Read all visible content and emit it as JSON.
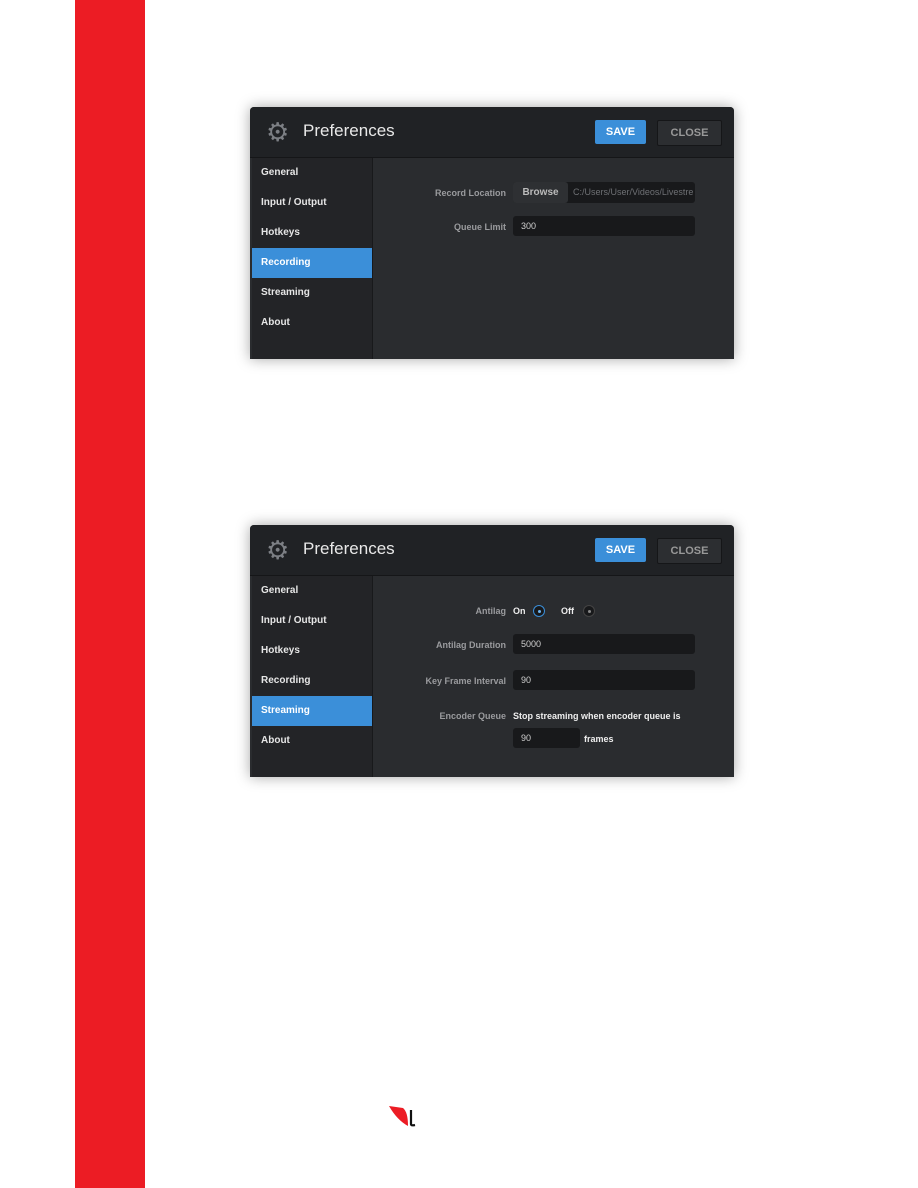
{
  "colors": {
    "accent_red": "#ec1c24",
    "accent_blue": "#3b8fd9"
  },
  "dialog": {
    "title": "Preferences",
    "icon": "gear-icon",
    "save_label": "SAVE",
    "close_label": "CLOSE",
    "sidebar": [
      "General",
      "Input / Output",
      "Hotkeys",
      "Recording",
      "Streaming",
      "About"
    ]
  },
  "recording": {
    "selected": "Recording",
    "record_location_label": "Record Location",
    "browse_label": "Browse",
    "record_path": "C:/Users/User/Videos/Livestre",
    "queue_limit_label": "Queue Limit",
    "queue_limit": "300"
  },
  "streaming": {
    "selected": "Streaming",
    "antilag_label": "Antilag",
    "on_label": "On",
    "off_label": "Off",
    "antilag_selected": "On",
    "antilag_duration_label": "Antilag Duration",
    "antilag_duration": "5000",
    "key_frame_label": "Key Frame Interval",
    "key_frame": "90",
    "encoder_queue_label": "Encoder Queue",
    "encoder_text": "Stop streaming when encoder queue is",
    "encoder_frames": "90",
    "frames_label": "frames"
  }
}
